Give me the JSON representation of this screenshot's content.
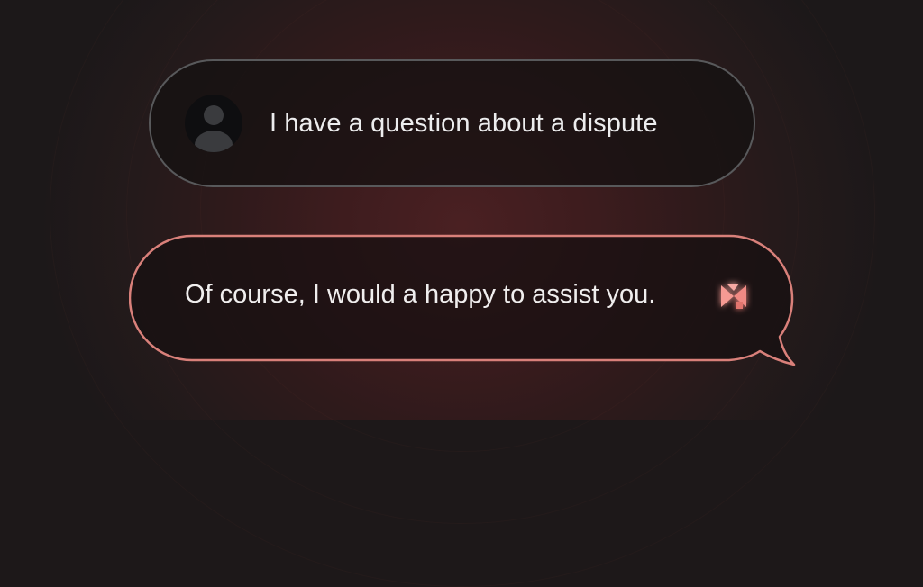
{
  "conversation": {
    "user_message": {
      "text": "I have a question about a dispute",
      "avatar_icon": "user-avatar-icon"
    },
    "assistant_message": {
      "text": "Of course, I would a happy to assist you.",
      "logo_icon": "assistant-logo-icon"
    }
  },
  "colors": {
    "background": "#1d1819",
    "glow": "#4a2022",
    "user_bubble_border": "#58595b",
    "assistant_bubble_border": "#d9807a",
    "accent": "#f08a84"
  }
}
